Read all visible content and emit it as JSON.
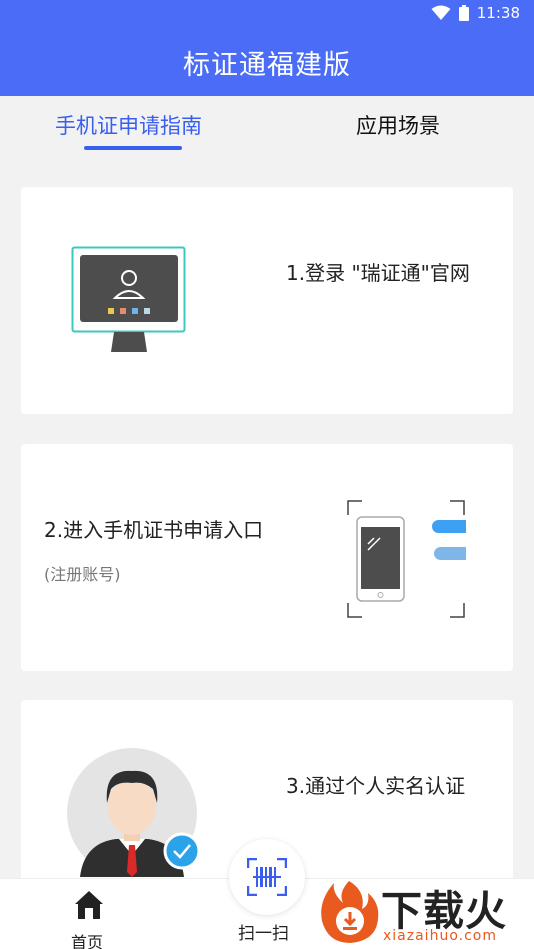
{
  "status": {
    "time": "11:38"
  },
  "header": {
    "title": "标证通福建版"
  },
  "tabs": [
    {
      "label": "手机证申请指南",
      "active": true
    },
    {
      "label": "应用场景",
      "active": false
    }
  ],
  "steps": [
    {
      "title": "1.登录 \"瑞证通\"官网"
    },
    {
      "title": "2.进入手机证书申请入口",
      "subtitle": "(注册账号)"
    },
    {
      "title": "3.通过个人实名认证"
    }
  ],
  "bottom_nav": {
    "home_label": "首页",
    "scan_label": "扫一扫"
  },
  "watermark": {
    "text": "下载火",
    "url": "xiazaihuo.com"
  },
  "colors": {
    "primary": "#4a6cf7",
    "accent": "#3a5ef0",
    "verified": "#2aa3e8",
    "watermark_orange": "#e65a1e"
  }
}
